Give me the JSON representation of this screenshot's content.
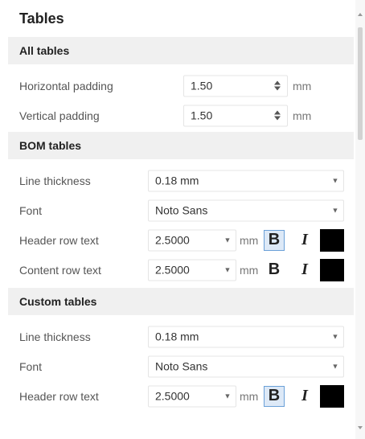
{
  "title": "Tables",
  "all_tables": {
    "header": "All tables",
    "horizontal_padding": {
      "label": "Horizontal padding",
      "value": "1.50",
      "unit": "mm"
    },
    "vertical_padding": {
      "label": "Vertical padding",
      "value": "1.50",
      "unit": "mm"
    }
  },
  "bom_tables": {
    "header": "BOM tables",
    "line_thickness": {
      "label": "Line thickness",
      "value": "0.18 mm"
    },
    "font": {
      "label": "Font",
      "value": "Noto Sans"
    },
    "header_row_text": {
      "label": "Header row text",
      "size": "2.5000",
      "unit": "mm",
      "bold_label": "B",
      "italic_label": "I",
      "bold_active": true,
      "color": "#000000"
    },
    "content_row_text": {
      "label": "Content row text",
      "size": "2.5000",
      "unit": "mm",
      "bold_label": "B",
      "italic_label": "I",
      "bold_active": false,
      "color": "#000000"
    }
  },
  "custom_tables": {
    "header": "Custom tables",
    "line_thickness": {
      "label": "Line thickness",
      "value": "0.18 mm"
    },
    "font": {
      "label": "Font",
      "value": "Noto Sans"
    },
    "header_row_text": {
      "label": "Header row text",
      "size": "2.5000",
      "unit": "mm",
      "bold_label": "B",
      "italic_label": "I",
      "bold_active": true,
      "color": "#000000"
    }
  },
  "colors": {
    "section_bg": "#f0f0f0",
    "active_bold_bg": "#dde9f7",
    "active_bold_border": "#6aa0d8"
  }
}
